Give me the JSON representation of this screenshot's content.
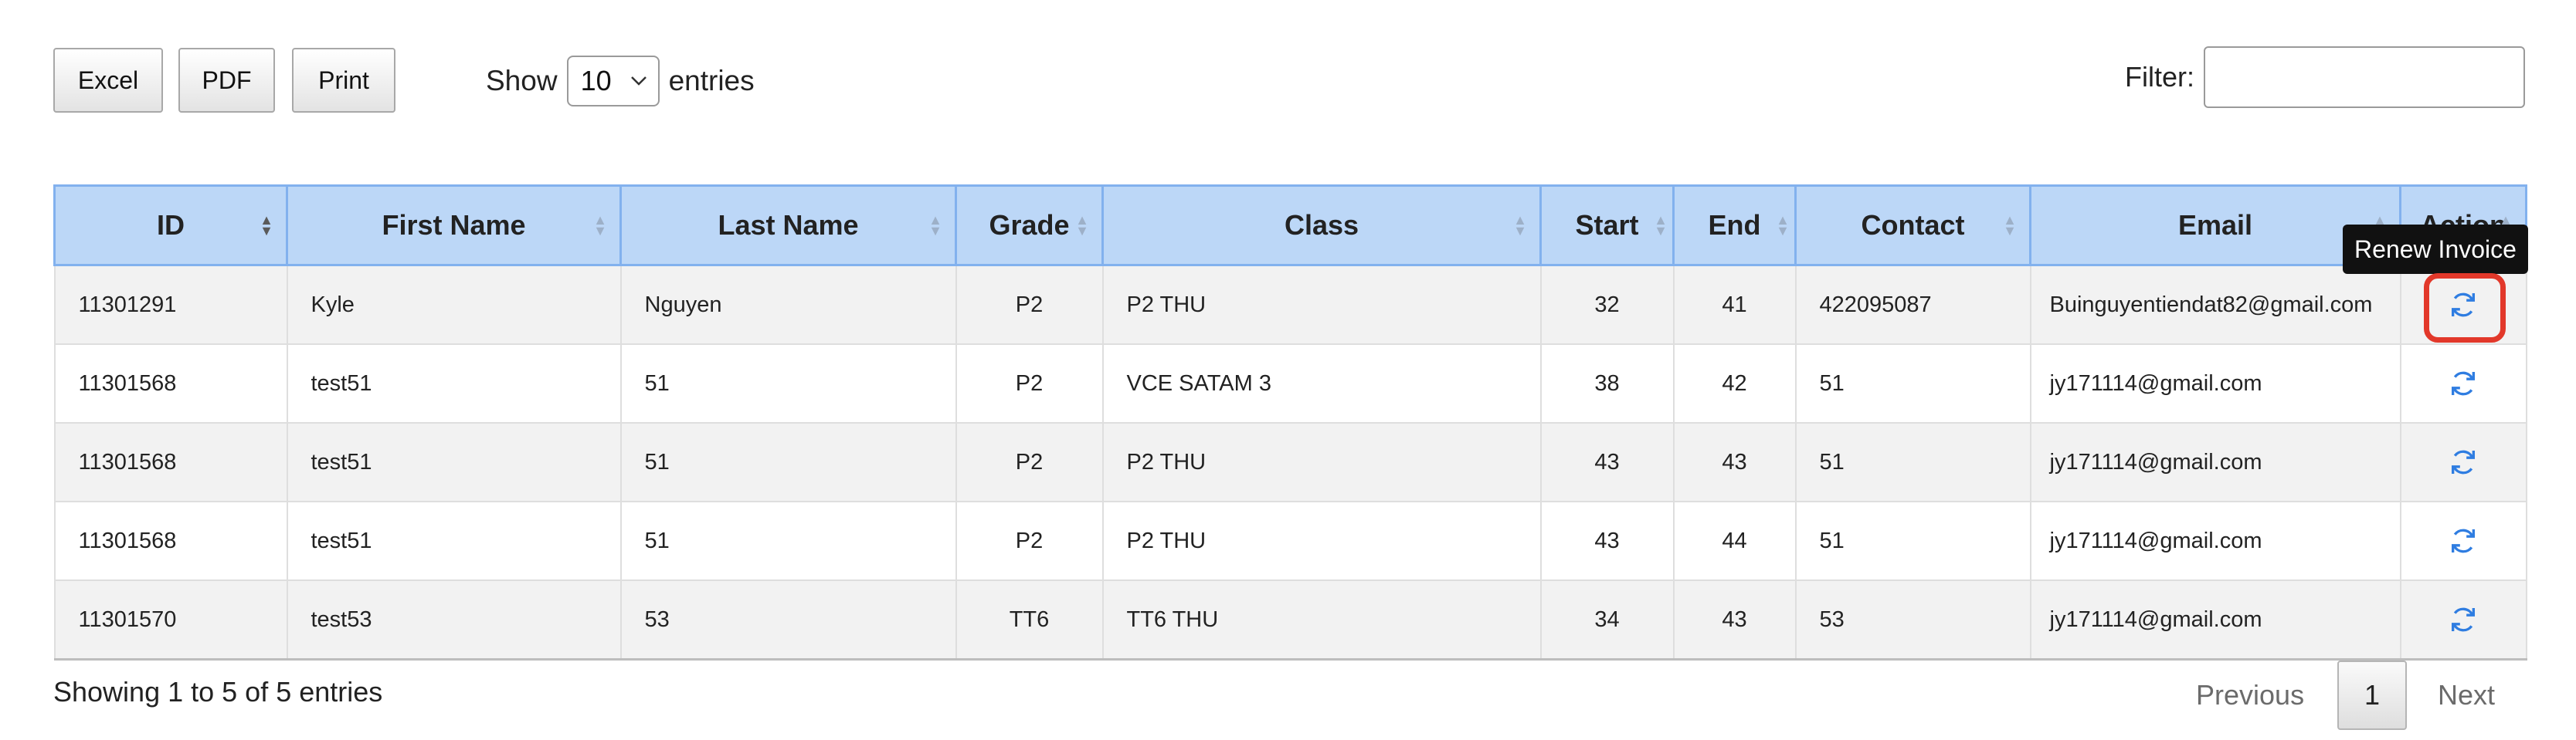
{
  "toolbar": {
    "excel_label": "Excel",
    "pdf_label": "PDF",
    "print_label": "Print"
  },
  "length": {
    "show_label": "Show",
    "selected": "10",
    "entries_label": "entries"
  },
  "filter": {
    "label": "Filter:",
    "value": "",
    "placeholder": ""
  },
  "table": {
    "columns": [
      "ID",
      "First Name",
      "Last Name",
      "Grade",
      "Class",
      "Start",
      "End",
      "Contact",
      "Email",
      "Action"
    ],
    "rows": [
      {
        "id": "11301291",
        "first": "Kyle",
        "last": "Nguyen",
        "grade": "P2",
        "class": "P2 THU",
        "start": "32",
        "end": "41",
        "contact": "422095087",
        "email": "Buinguyentiendat82@gmail.com"
      },
      {
        "id": "11301568",
        "first": "test51",
        "last": "51",
        "grade": "P2",
        "class": "VCE SATAM 3",
        "start": "38",
        "end": "42",
        "contact": "51",
        "email": "jy171114@gmail.com"
      },
      {
        "id": "11301568",
        "first": "test51",
        "last": "51",
        "grade": "P2",
        "class": "P2 THU",
        "start": "43",
        "end": "43",
        "contact": "51",
        "email": "jy171114@gmail.com"
      },
      {
        "id": "11301568",
        "first": "test51",
        "last": "51",
        "grade": "P2",
        "class": "P2 THU",
        "start": "43",
        "end": "44",
        "contact": "51",
        "email": "jy171114@gmail.com"
      },
      {
        "id": "11301570",
        "first": "test53",
        "last": "53",
        "grade": "TT6",
        "class": "TT6 THU",
        "start": "34",
        "end": "43",
        "contact": "53",
        "email": "jy171114@gmail.com"
      }
    ],
    "action_icon": "refresh-icon"
  },
  "tooltip": {
    "text": "Renew Invoice"
  },
  "footer": {
    "info": "Showing 1 to 5 of 5 entries",
    "previous": "Previous",
    "page": "1",
    "next": "Next"
  },
  "colors": {
    "header_bg": "#bcd7f7",
    "header_border": "#82b1ee",
    "icon_blue": "#2f7de1",
    "highlight_red": "#e2382a"
  }
}
